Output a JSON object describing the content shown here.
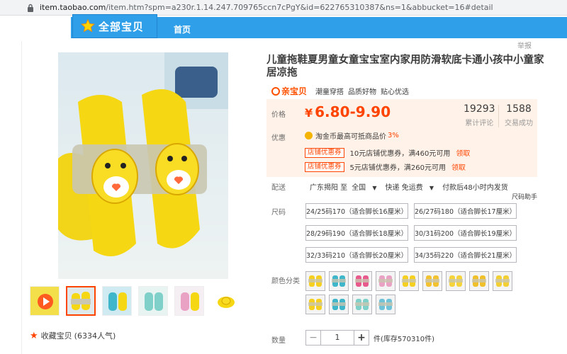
{
  "browser": {
    "url_host": "item.taobao.com",
    "url_rest": "/item.htm?spm=a230r.1.14.247.709765ccn7cPgY&id=622765310387&ns=1&abbucket=16#detail"
  },
  "shop_nav": {
    "all_items_label": "全部宝贝",
    "home_label": "首页",
    "report_label": "举报"
  },
  "product": {
    "title": "儿童拖鞋夏男童女童宝宝室内家用防滑软底卡通小孩中小童家居凉拖",
    "promo_logo": "亲宝贝",
    "promo_tags": [
      "潮童穿搭",
      "品质好物",
      "贴心优选"
    ]
  },
  "price": {
    "label": "价格",
    "currency": "¥",
    "value": "6.80-9.90",
    "reviews_count": "19293",
    "reviews_label": "累计评论",
    "sales_count": "1588",
    "sales_label": "交易成功",
    "offers_label": "优惠",
    "coin_text": "淘金币最高可抵商品价",
    "coin_pct": "3%",
    "coupons": [
      {
        "tag": "店铺优惠券",
        "desc": "10元店铺优惠券，满460元可用",
        "link": "领取"
      },
      {
        "tag": "店铺优惠券",
        "desc": "5元店铺优惠券，满260元可用",
        "link": "领取"
      }
    ]
  },
  "shipping": {
    "label": "配送",
    "from": "广东揭阳 至",
    "to": "全国",
    "express": "快递 免运费",
    "note": "付款后48小时内发货"
  },
  "sizes": {
    "label": "尺码",
    "help": "尺码助手",
    "options": [
      "24/25码170（适合脚长16厘米）",
      "26/27码180（适合脚长17厘米）",
      "28/29码190（适合脚长18厘米）",
      "30/31码200（适合脚长19厘米）",
      "32/33码210（适合脚长20厘米）",
      "34/35码220（适合脚长21厘米）"
    ]
  },
  "colors": {
    "label": "颜色分类",
    "swatches": [
      "#f5d020",
      "#3fb6c9",
      "#e85a8c",
      "#e9a2c4",
      "#f5d020",
      "#f2c230",
      "#f4d43a",
      "#f0c02a",
      "#f2cf33",
      "#f5d020",
      "#3fb6c9",
      "#7ed0c9",
      "#6fc3d8"
    ]
  },
  "quantity": {
    "label": "数量",
    "value": "1",
    "stock": "件(库存570310件)"
  },
  "favorite": {
    "label": "收藏宝贝",
    "count": "(6334人气)"
  },
  "colors_accent": {
    "brand": "#ff4400",
    "nav": "#2e9fe8",
    "price_bg": "#fff2e8"
  }
}
